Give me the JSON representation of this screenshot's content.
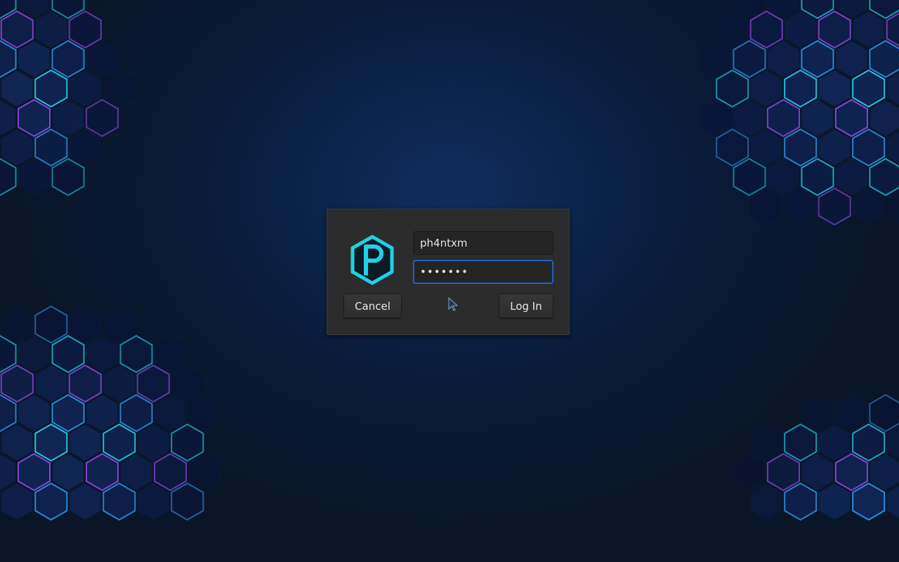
{
  "desktop": {
    "background_color": "#0b2248"
  },
  "login": {
    "logo_icon": "hexagon-p-logo",
    "logo_color": "#1fd1e6",
    "username_value": "ph4ntxm",
    "password_mask": "•••••••",
    "cancel_label": "Cancel",
    "login_label": "Log In"
  },
  "cursor": {
    "icon": "arrow-pointer"
  }
}
